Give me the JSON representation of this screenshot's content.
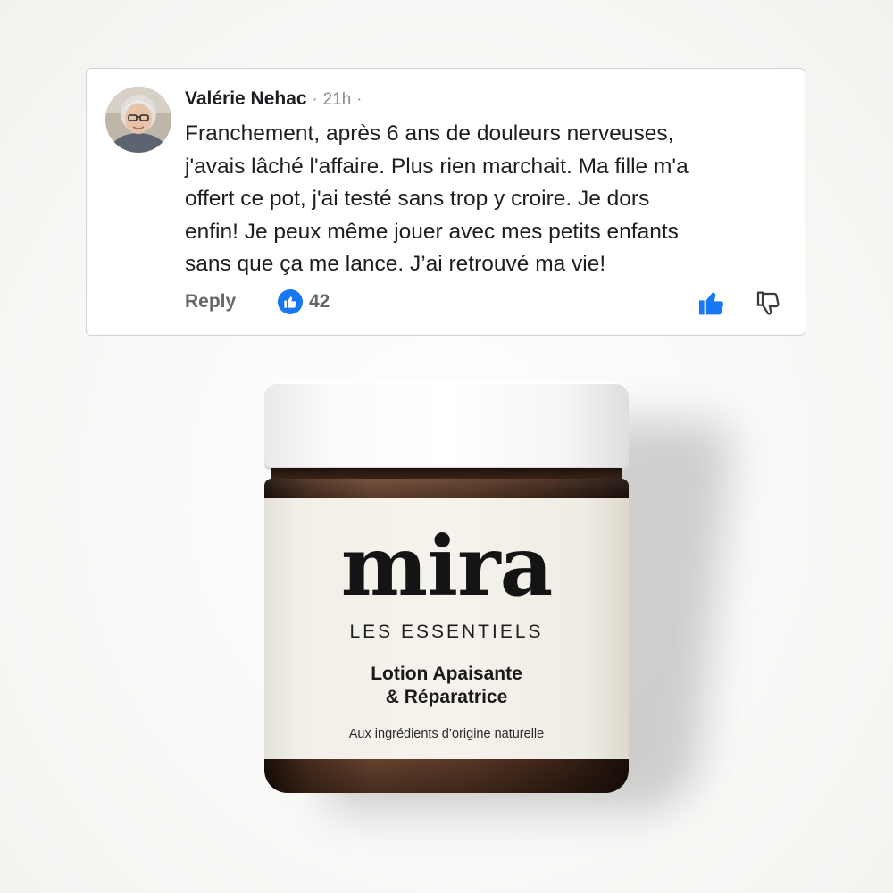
{
  "comment": {
    "author": "Valérie Nehac",
    "separator_before_time": "·",
    "timestamp": "21h",
    "separator_after_time": "·",
    "body_lines": [
      "Franchement, après 6 ans de douleurs nerveuses,",
      "j'avais lâché l'affaire. Plus rien marchait. Ma fille m'a",
      "offert ce pot, j'ai testé sans trop y croire. Je dors",
      "enfin! Je peux même jouer avec mes petits enfants",
      "sans que ça me lance. J’ai retrouvé ma vie!"
    ],
    "reply_label": "Reply",
    "reaction_count": "42",
    "like_icon": "thumbs-up-icon",
    "dislike_icon": "thumbs-down-icon",
    "accent_color": "#1877f2"
  },
  "product": {
    "brand": "mira",
    "tagline": "LES ESSENTIELS",
    "name_lines": [
      "Lotion Apaisante",
      "& Réparatrice"
    ],
    "subtitle": "Aux ingrédients d’origine naturelle"
  }
}
